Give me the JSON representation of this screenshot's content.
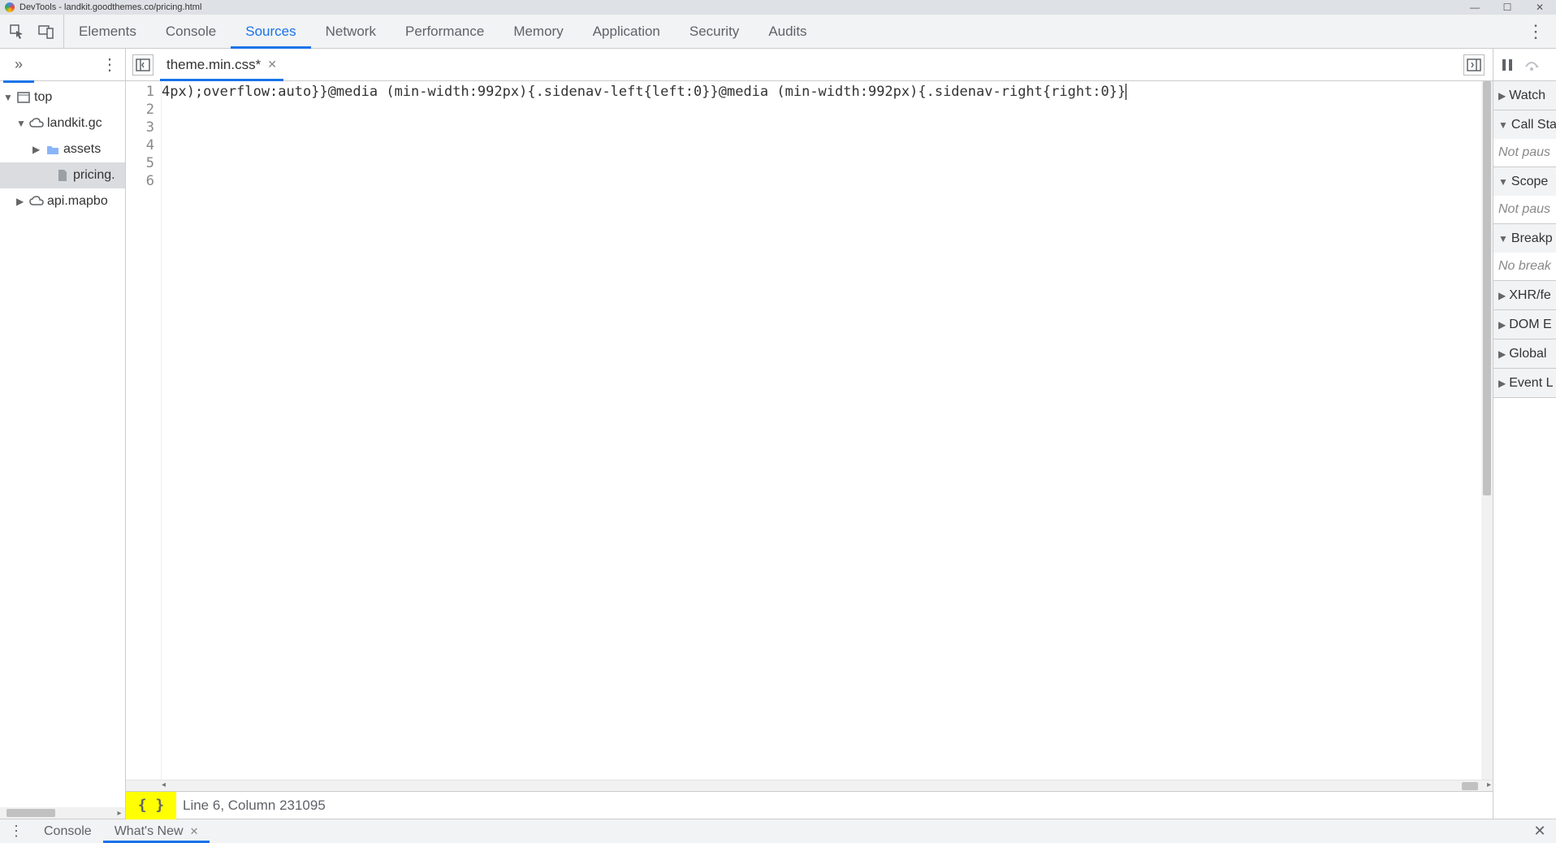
{
  "window": {
    "title": "DevTools - landkit.goodthemes.co/pricing.html"
  },
  "main_tabs": [
    "Elements",
    "Console",
    "Sources",
    "Network",
    "Performance",
    "Memory",
    "Application",
    "Security",
    "Audits"
  ],
  "main_tabs_active": "Sources",
  "navigator": {
    "tree": {
      "root": "top",
      "domain": "landkit.gc",
      "folder": "assets",
      "file": "pricing.",
      "other_domain": "api.mapbo"
    }
  },
  "editor": {
    "tab_name": "theme.min.css*",
    "line_numbers": [
      "1",
      "2",
      "3",
      "4",
      "5",
      "6"
    ],
    "lines": [
      "",
      "",
      "",
      "",
      "",
      "4px);overflow:auto}}@media (min-width:992px){.sidenav-left{left:0}}@media (min-width:992px){.sidenav-right{right:0}}"
    ],
    "status": "Line 6, Column 231095",
    "pretty_label": "{ }"
  },
  "debugger": {
    "sections": [
      {
        "label": "Watch",
        "expanded": false
      },
      {
        "label": "Call Sta",
        "expanded": true,
        "body": "Not paus"
      },
      {
        "label": "Scope",
        "expanded": true,
        "body": "Not paus"
      },
      {
        "label": "Breakp",
        "expanded": true,
        "body": "No break"
      },
      {
        "label": "XHR/fe",
        "expanded": false
      },
      {
        "label": "DOM E",
        "expanded": false
      },
      {
        "label": "Global",
        "expanded": false
      },
      {
        "label": "Event L",
        "expanded": false
      }
    ]
  },
  "drawer": {
    "tabs": [
      "Console",
      "What's New"
    ],
    "active": "What's New"
  }
}
